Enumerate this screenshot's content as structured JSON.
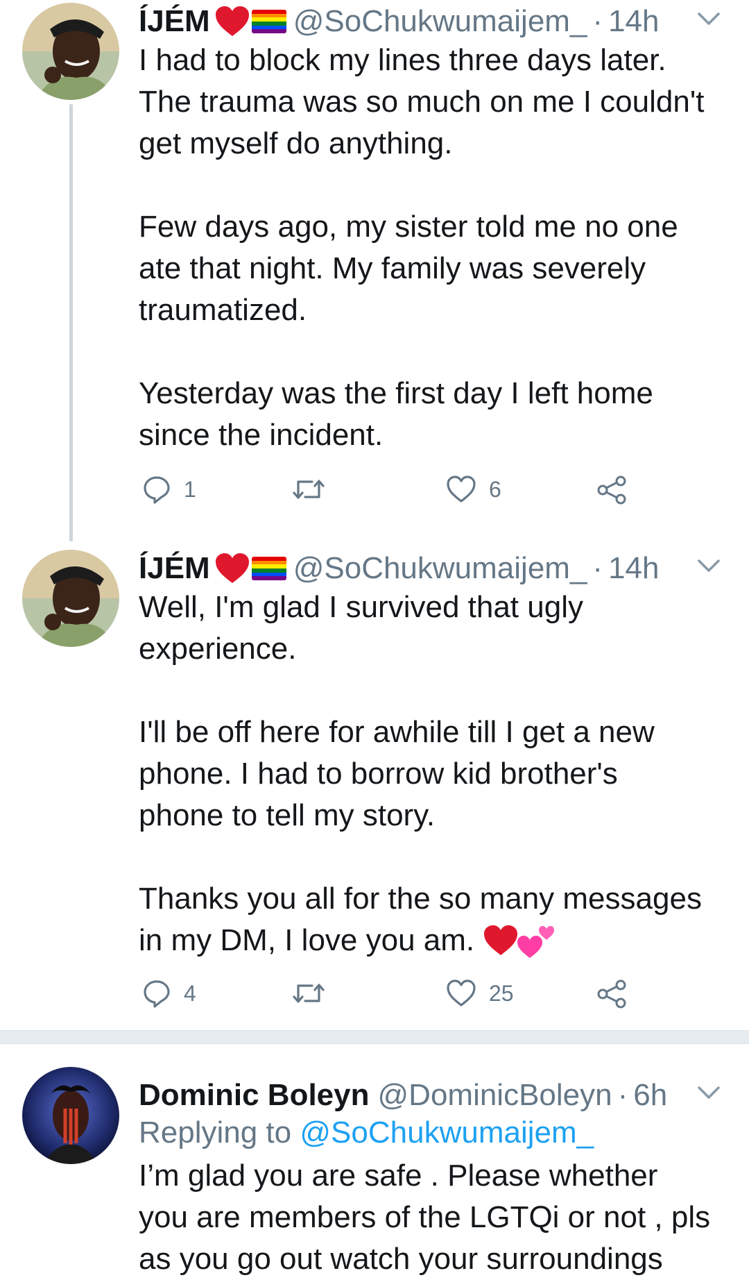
{
  "tweets": [
    {
      "name": "ÍJÉM",
      "handle": "@SoChukwumaijem_",
      "dot": "·",
      "time": "14h",
      "text": [
        "I had to block my lines three days later.",
        "The trauma was so much on me I couldn't",
        "get myself do anything.",
        "",
        "Few days ago, my sister told me no one",
        "ate that night. My family was severely",
        "traumatized.",
        "",
        "Yesterday was the first day I left home",
        "since the incident."
      ],
      "reply_count": "1",
      "retweet_count": "",
      "like_count": "6"
    },
    {
      "name": "ÍJÉM",
      "handle": "@SoChukwumaijem_",
      "dot": "·",
      "time": "14h",
      "text": [
        "Well, I'm glad I survived that ugly",
        "experience.",
        "",
        "I'll be off here for awhile till I get a new",
        "phone. I had to borrow kid brother's",
        "phone to tell my story.",
        "",
        "Thanks you all for the so many messages",
        "in my DM, I love you am."
      ],
      "reply_count": "4",
      "retweet_count": "",
      "like_count": "25"
    },
    {
      "name": "Dominic Boleyn",
      "handle": "@DominicBoleyn",
      "dot": "·",
      "time": "6h",
      "replying_prefix": "Replying to",
      "replying_to": "@SoChukwumaijem_",
      "text": [
        "I’m glad you are safe . Please whether",
        "you are members of the LGTQi or not , pls",
        "as you go out watch your surroundings"
      ]
    }
  ],
  "icons": {
    "reply": "reply-icon",
    "retweet": "retweet-icon",
    "like": "heart-icon",
    "share": "share-icon",
    "more": "chevron-down-icon"
  },
  "colors": {
    "secondary_text": "#657786",
    "link": "#1da1f2",
    "thread_line": "#cdd5dd",
    "separator": "#e6ecf0",
    "heart_emoji": "#e0182d"
  }
}
